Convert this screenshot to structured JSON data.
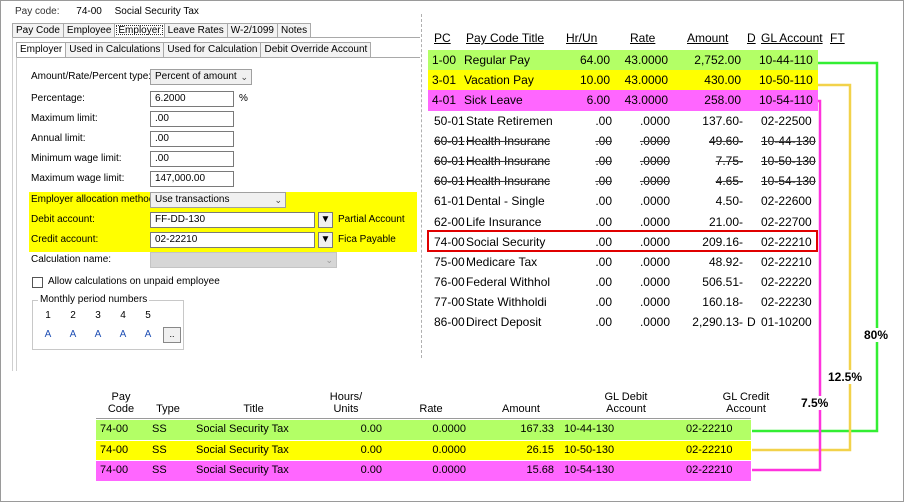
{
  "colors": {
    "green": "#b3ff66",
    "yellow": "#ffff00",
    "magenta": "#ff66ff",
    "red": "#e00000",
    "line_green": "#33ee33",
    "line_yellow": "#f2d24a",
    "line_magenta": "#ff33dd"
  },
  "dialog": {
    "pay_code_label": "Pay code:",
    "pay_code_value": "74-00",
    "pay_code_desc": "Social Security Tax",
    "tabs": [
      "Pay Code",
      "Employee",
      "Employer",
      "Leave Rates",
      "W-2/1099",
      "Notes"
    ],
    "active_tab": "Employer",
    "subtabs": [
      "Employer",
      "Used in Calculations",
      "Used for Calculation",
      "Debit Override Account"
    ],
    "active_subtab": "Employer",
    "fields": {
      "amount_type_label": "Amount/Rate/Percent type:",
      "amount_type_value": "Percent of amount",
      "percentage_label": "Percentage:",
      "percentage_value": "6.2000",
      "percentage_unit": "%",
      "max_limit_label": "Maximum limit:",
      "max_limit_value": ".00",
      "annual_limit_label": "Annual limit:",
      "annual_limit_value": ".00",
      "min_wage_label": "Minimum wage limit:",
      "min_wage_value": ".00",
      "max_wage_label": "Maximum wage limit:",
      "max_wage_value": "147,000.00",
      "alloc_label": "Employer allocation method:",
      "alloc_value": "Use transactions",
      "debit_label": "Debit account:",
      "debit_value": "FF-DD-130",
      "debit_desc": "Partial Account",
      "credit_label": "Credit account:",
      "credit_value": "02-22210",
      "credit_desc": "Fica Payable",
      "calc_name_label": "Calculation name:",
      "allow_calc_label": "Allow calculations on unpaid employee"
    },
    "monthly": {
      "title": "Monthly period numbers",
      "periods": [
        "1",
        "2",
        "3",
        "4",
        "5"
      ],
      "values": [
        "A",
        "A",
        "A",
        "A",
        "A"
      ],
      "more_button": ".."
    }
  },
  "pay_table": {
    "headers": {
      "pc": "PC",
      "title": "Pay Code Title",
      "hr": "Hr/Un",
      "rate": "Rate",
      "amount": "Amount",
      "d": "D",
      "gl": "GL Account",
      "ft": "FT"
    },
    "rows": [
      {
        "pc": "1-00",
        "title": "Regular Pay",
        "hr": "64.00",
        "rate": "43.0000",
        "amount": "2,752.00",
        "d": "",
        "gl": "10-44-110",
        "hl": "green"
      },
      {
        "pc": "3-01",
        "title": "Vacation Pay",
        "hr": "10.00",
        "rate": "43.0000",
        "amount": "430.00",
        "d": "",
        "gl": "10-50-110",
        "hl": "yellow"
      },
      {
        "pc": "4-01",
        "title": "Sick Leave",
        "hr": "6.00",
        "rate": "43.0000",
        "amount": "258.00",
        "d": "",
        "gl": "10-54-110",
        "hl": "magenta"
      },
      {
        "pc": "50-01",
        "title": "State Retiremen",
        "hr": ".00",
        "rate": ".0000",
        "amount": "137.60-",
        "d": "",
        "gl": "02-22500",
        "hl": ""
      },
      {
        "pc": "60-01",
        "title": "Health Insuranc",
        "hr": ".00",
        "rate": ".0000",
        "amount": "49.60-",
        "d": "",
        "gl": "10-44-130",
        "hl": "",
        "void": true
      },
      {
        "pc": "60-01",
        "title": "Health Insuranc",
        "hr": ".00",
        "rate": ".0000",
        "amount": "7.75-",
        "d": "",
        "gl": "10-50-130",
        "hl": "",
        "void": true
      },
      {
        "pc": "60-01",
        "title": "Health Insuranc",
        "hr": ".00",
        "rate": ".0000",
        "amount": "4.65-",
        "d": "",
        "gl": "10-54-130",
        "hl": "",
        "void": true
      },
      {
        "pc": "61-01",
        "title": "Dental - Single",
        "hr": ".00",
        "rate": ".0000",
        "amount": "4.50-",
        "d": "",
        "gl": "02-22600",
        "hl": ""
      },
      {
        "pc": "62-00",
        "title": "Life Insurance",
        "hr": ".00",
        "rate": ".0000",
        "amount": "21.00-",
        "d": "",
        "gl": "02-22700",
        "hl": ""
      },
      {
        "pc": "74-00",
        "title": "Social Security",
        "hr": ".00",
        "rate": ".0000",
        "amount": "209.16-",
        "d": "",
        "gl": "02-22210",
        "hl": ""
      },
      {
        "pc": "75-00",
        "title": "Medicare Tax",
        "hr": ".00",
        "rate": ".0000",
        "amount": "48.92-",
        "d": "",
        "gl": "02-22210",
        "hl": ""
      },
      {
        "pc": "76-00",
        "title": "Federal Withhol",
        "hr": ".00",
        "rate": ".0000",
        "amount": "506.51-",
        "d": "",
        "gl": "02-22220",
        "hl": ""
      },
      {
        "pc": "77-00",
        "title": "State Withholdi",
        "hr": ".00",
        "rate": ".0000",
        "amount": "160.18-",
        "d": "",
        "gl": "02-22230",
        "hl": ""
      },
      {
        "pc": "86-00",
        "title": "Direct Deposit",
        "hr": ".00",
        "rate": ".0000",
        "amount": "2,290.13-",
        "d": "D",
        "gl": "01-10200",
        "hl": ""
      }
    ]
  },
  "dist_table": {
    "headers": {
      "pay_code": "Pay\nCode",
      "type": "Type",
      "title": "Title",
      "hours": "Hours/\nUnits",
      "rate": "Rate",
      "amount": "Amount",
      "gl_debit": "GL Debit\nAccount",
      "gl_credit": "GL Credit\nAccount"
    },
    "rows": [
      {
        "pay_code": "74-00",
        "type": "SS",
        "title": "Social Security Tax",
        "hours": "0.00",
        "rate": "0.0000",
        "amount": "167.33",
        "gl_debit": "10-44-130",
        "gl_credit": "02-22210",
        "hl": "green"
      },
      {
        "pay_code": "74-00",
        "type": "SS",
        "title": "Social Security Tax",
        "hours": "0.00",
        "rate": "0.0000",
        "amount": "26.15",
        "gl_debit": "10-50-130",
        "gl_credit": "02-22210",
        "hl": "yellow"
      },
      {
        "pay_code": "74-00",
        "type": "SS",
        "title": "Social Security Tax",
        "hours": "0.00",
        "rate": "0.0000",
        "amount": "15.68",
        "gl_debit": "10-54-130",
        "gl_credit": "02-22210",
        "hl": "magenta"
      }
    ]
  },
  "allocations": {
    "green": "80%",
    "yellow": "12.5%",
    "magenta": "7.5%"
  }
}
